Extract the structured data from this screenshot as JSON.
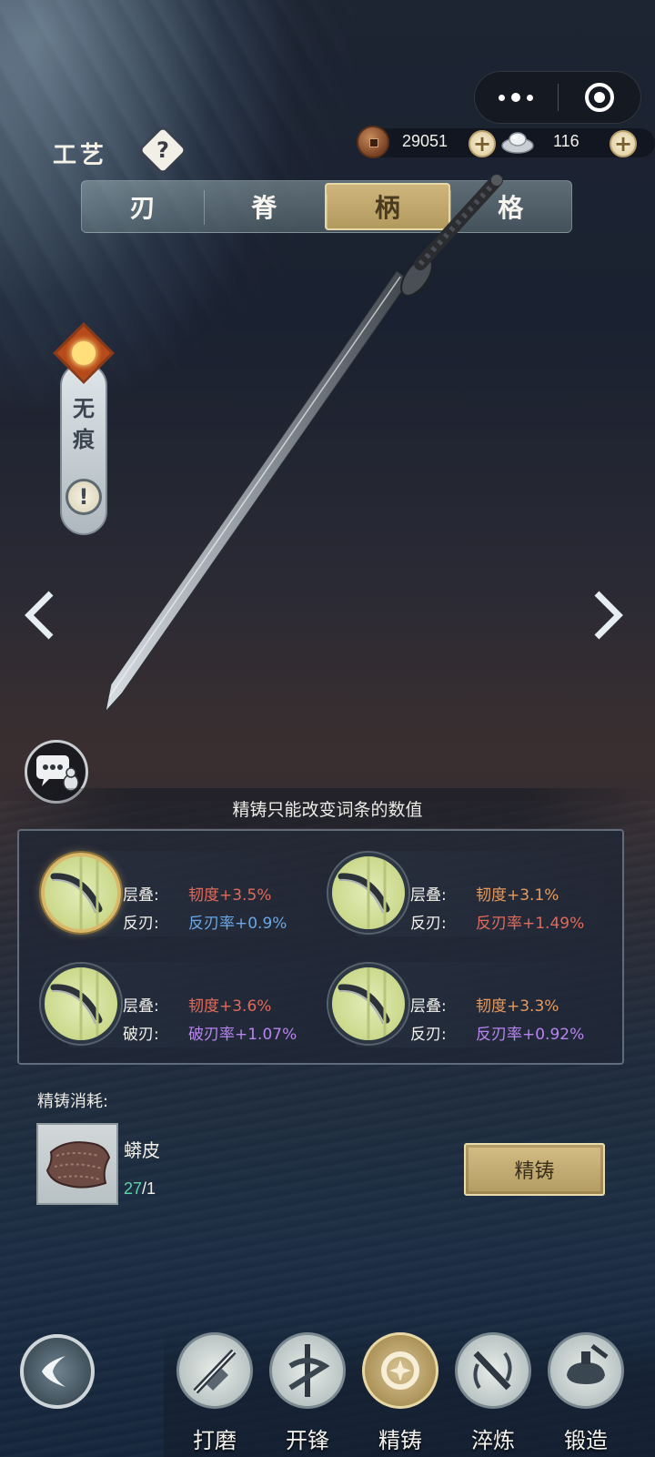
{
  "header": {
    "title": "工艺",
    "help_label": "?",
    "copper": "29051",
    "silver": "116",
    "plus": "+"
  },
  "tabs": [
    {
      "label": "刃",
      "active": false
    },
    {
      "label": "脊",
      "active": false
    },
    {
      "label": "柄",
      "active": true
    },
    {
      "label": "格",
      "active": false
    }
  ],
  "weapon": {
    "name": "无痕",
    "alert": "!"
  },
  "hint": "精铸只能改变词条的数值",
  "options": [
    {
      "line1_label": "层叠:",
      "line1_value": "韧度+3.5%",
      "line1_color": "#e26a5a",
      "line2_label": "反刃:",
      "line2_value": "反刃率+0.9%",
      "line2_color": "#6aa8e6",
      "selected": true
    },
    {
      "line1_label": "层叠:",
      "line1_value": "韧度+3.1%",
      "line1_color": "#e89a5a",
      "line2_label": "反刃:",
      "line2_value": "反刃率+1.49%",
      "line2_color": "#e26a5a",
      "selected": false
    },
    {
      "line1_label": "层叠:",
      "line1_value": "韧度+3.6%",
      "line1_color": "#e26a5a",
      "line2_label": "破刃:",
      "line2_value": "破刃率+1.07%",
      "line2_color": "#b884f0",
      "selected": false
    },
    {
      "line1_label": "层叠:",
      "line1_value": "韧度+3.3%",
      "line1_color": "#e89a5a",
      "line2_label": "反刃:",
      "line2_value": "反刃率+0.92%",
      "line2_color": "#b884f0",
      "selected": false
    }
  ],
  "cost": {
    "title": "精铸消耗:",
    "material_name": "蟒皮",
    "have": "27",
    "need": "/1",
    "button_label": "精铸"
  },
  "bottom_nav": [
    {
      "label": "打磨",
      "icon": "grind-icon",
      "active": false
    },
    {
      "label": "开锋",
      "icon": "edge-icon",
      "active": false
    },
    {
      "label": "精铸",
      "icon": "refine-cast-icon",
      "active": true
    },
    {
      "label": "淬炼",
      "icon": "temper-icon",
      "active": false
    },
    {
      "label": "锻造",
      "icon": "forge-icon",
      "active": false
    }
  ],
  "colors": {
    "accent_gold": "#c9b27a",
    "red": "#e26a5a",
    "orange": "#e89a5a",
    "blue": "#6aa8e6",
    "purple": "#b884f0",
    "count_green": "#5cd4a8"
  }
}
